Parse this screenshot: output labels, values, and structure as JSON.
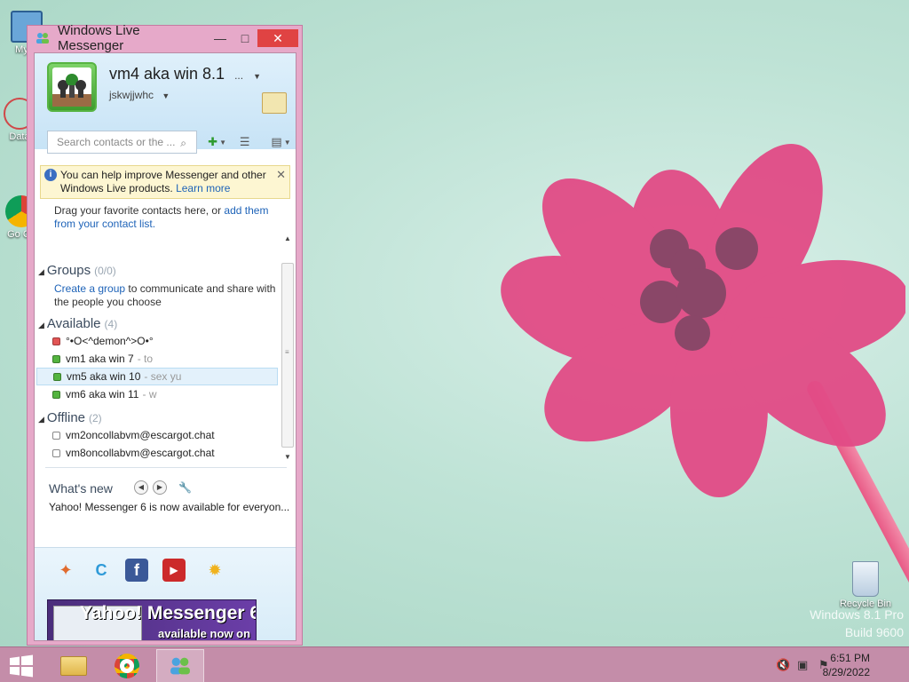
{
  "window": {
    "title": "Windows Live Messenger",
    "minimize_glyph": "—",
    "maximize_glyph": "□",
    "close_glyph": "✕"
  },
  "profile": {
    "display_name": "vm4 aka win 8.1",
    "display_name_more": "...",
    "personal_message": "jskwjjwhc"
  },
  "search": {
    "placeholder": "Search contacts or the ..."
  },
  "infobar": {
    "text": "You can help improve Messenger and other Windows Live products.",
    "link": "Learn more"
  },
  "drag_hint": {
    "text": "Drag your favorite contacts here, or ",
    "link": "add them from your contact list."
  },
  "groups": {
    "header": "Groups",
    "count": "(0/0)",
    "link": "Create a group",
    "desc": " to communicate and share with the people you choose"
  },
  "available": {
    "header": "Available",
    "count": "(4)",
    "contacts": [
      {
        "name": "°•O<^demon^>O•°",
        "psm": "",
        "status": "busy"
      },
      {
        "name": "vm1 aka win 7",
        "psm": "- to",
        "status": "online"
      },
      {
        "name": "vm5 aka win 10",
        "psm": "- sex yu",
        "status": "online"
      },
      {
        "name": "vm6 aka win 11",
        "psm": "- w",
        "status": "online"
      }
    ]
  },
  "offline": {
    "header": "Offline",
    "count": "(2)",
    "contacts": [
      {
        "name": "vm2oncollabvm@escargot.chat",
        "status": "offline"
      },
      {
        "name": "vm8oncollabvm@escargot.chat",
        "status": "offline"
      }
    ]
  },
  "whats_new": {
    "header": "What's new",
    "news": "Yahoo! Messenger 6 is now available for everyon..."
  },
  "banner": {
    "title": "Yahoo! Messenger 6",
    "subtitle": "available now on NINA & Escargot"
  },
  "desktop": {
    "icons": [
      {
        "label": "My C"
      },
      {
        "label": "Data"
      },
      {
        "label": "Go Ch"
      },
      {
        "label": "Recycle Bin"
      }
    ],
    "watermark_line1": "Windows 8.1 Pro",
    "watermark_line2": "Build 9600"
  },
  "taskbar": {
    "time": "6:51 PM",
    "date": "8/29/2022"
  },
  "colors": {
    "accent_pink": "#c48da9",
    "window_border": "#e6a9c9",
    "link_blue": "#1e63b8",
    "status_online": "#53b43f",
    "status_busy": "#e25555"
  }
}
